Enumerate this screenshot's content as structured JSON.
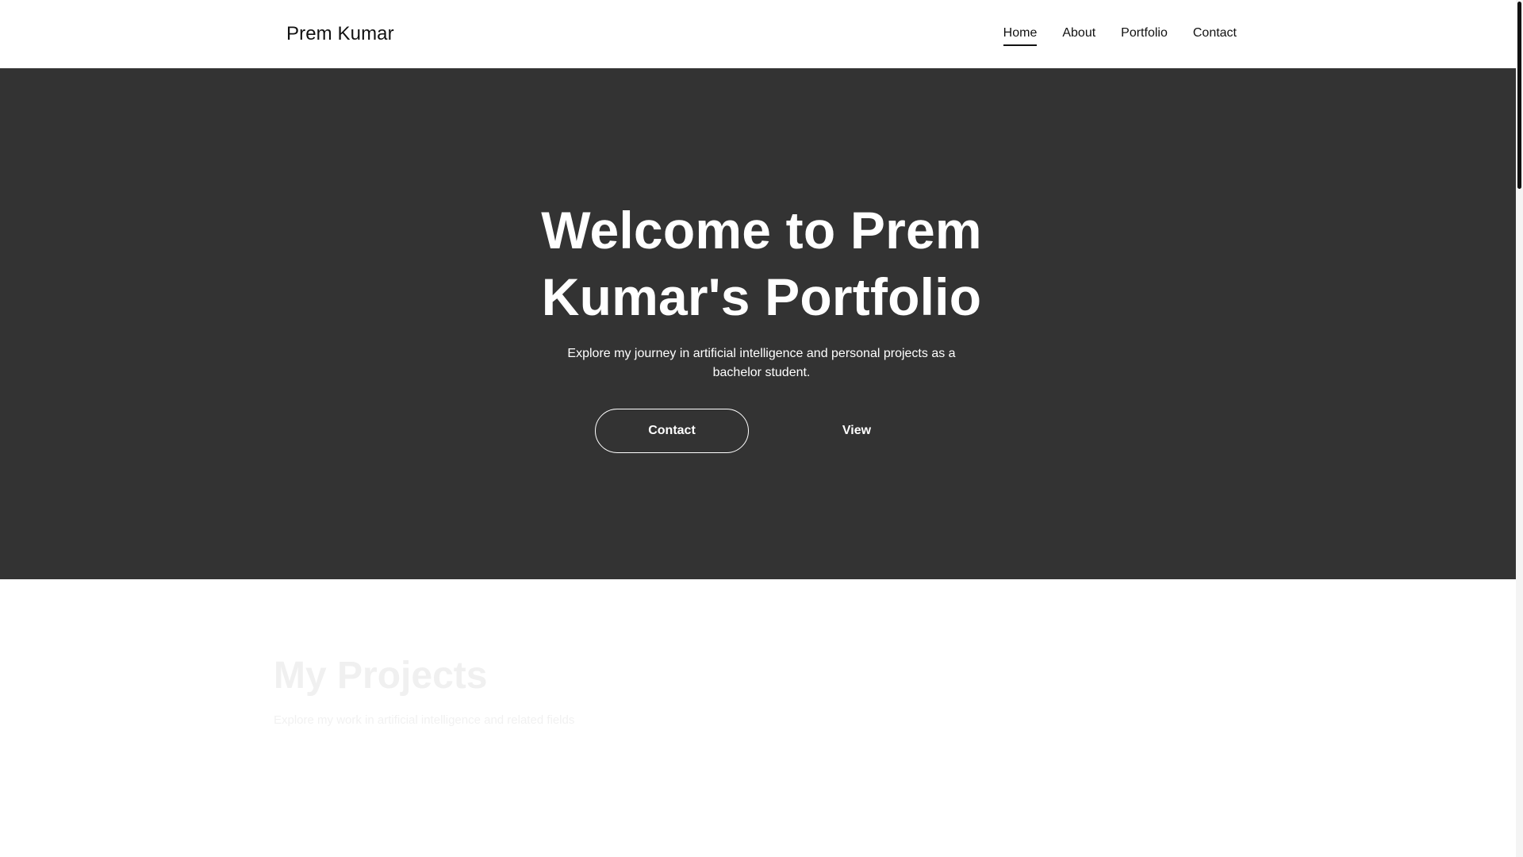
{
  "header": {
    "brand": "Prem Kumar",
    "nav": [
      {
        "label": "Home",
        "active": true
      },
      {
        "label": "About",
        "active": false
      },
      {
        "label": "Portfolio",
        "active": false
      },
      {
        "label": "Contact",
        "active": false
      }
    ]
  },
  "hero": {
    "title_line1": "Welcome to Prem",
    "title_line2": "Kumar's Portfolio",
    "subtitle": "Explore my journey in artificial intelligence and personal projects as a bachelor student.",
    "primary_button": "Contact",
    "secondary_button": "View"
  },
  "projects": {
    "title": "My Projects",
    "subtitle": "Explore my work in artificial intelligence and related fields"
  },
  "colors": {
    "hero_bg": "#333333",
    "text_dark": "#111111",
    "text_light": "#ffffff"
  }
}
